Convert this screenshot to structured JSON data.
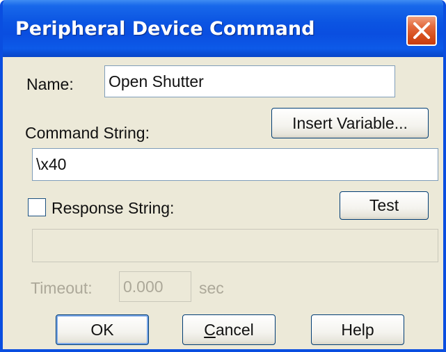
{
  "window": {
    "title": "Peripheral Device Command",
    "close_icon": "close-icon"
  },
  "form": {
    "name_label": "Name:",
    "name_value": "Open Shutter",
    "command_label": "Command String:",
    "insert_variable_label": "Insert Variable...",
    "command_value": "\\x40",
    "response_checked": false,
    "response_label": "Response String:",
    "test_label": "Test",
    "response_value": "",
    "timeout_label": "Timeout:",
    "timeout_value": "0.000",
    "timeout_unit": "sec"
  },
  "buttons": {
    "ok_label": "OK",
    "cancel_mnemonic": "C",
    "cancel_rest": "ancel",
    "help_label": "Help"
  },
  "colors": {
    "titlebar": "#0a4ee0",
    "close_button": "#d64e1c",
    "dialog_background": "#ece9d8",
    "disabled_text": "#aca899"
  }
}
